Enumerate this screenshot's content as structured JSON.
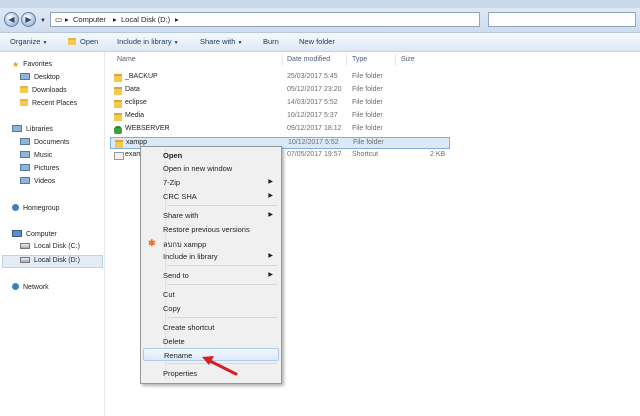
{
  "address": {
    "crumbs": [
      "Computer",
      "Local Disk (D:)"
    ]
  },
  "toolbar": {
    "organize": "Organize",
    "open": "Open",
    "include_in_library": "Include in library",
    "share_with": "Share with",
    "burn": "Burn",
    "new_folder": "New folder"
  },
  "nav": {
    "favorites": "Favorites",
    "desktop": "Desktop",
    "downloads": "Downloads",
    "recent_places": "Recent Places",
    "libraries": "Libraries",
    "documents": "Documents",
    "music": "Music",
    "pictures": "Pictures",
    "videos": "Videos",
    "homegroup": "Homegroup",
    "computer": "Computer",
    "local_c": "Local Disk (C:)",
    "local_d": "Local Disk (D:)",
    "network": "Network"
  },
  "columns": {
    "name": "Name",
    "date_modified": "Date modified",
    "type": "Type",
    "size": "Size"
  },
  "files": [
    {
      "name": "_BACKUP",
      "date": "25/03/2017 5:45",
      "type": "File folder",
      "size": ""
    },
    {
      "name": "Data",
      "date": "05/12/2017 23:20",
      "type": "File folder",
      "size": ""
    },
    {
      "name": "eclipse",
      "date": "14/03/2017 5:52",
      "type": "File folder",
      "size": ""
    },
    {
      "name": "Media",
      "date": "10/12/2017 5:37",
      "type": "File folder",
      "size": ""
    },
    {
      "name": "WEBSERVER",
      "date": "09/12/2017 18:12",
      "type": "File folder",
      "size": ""
    },
    {
      "name": "xampp",
      "date": "10/12/2017 5:52",
      "type": "File folder",
      "size": ""
    },
    {
      "name": "exam",
      "date": "07/05/2017 19:57",
      "type": "Shortcut",
      "size": "2 KB"
    }
  ],
  "context_menu": {
    "open": "Open",
    "open_new_window": "Open in new window",
    "seven_zip": "7-Zip",
    "crc_sha": "CRC SHA",
    "share_with": "Share with",
    "restore_previous": "Restore previous versions",
    "xampp_item": "ลบกบ xampp",
    "include_in_library": "Include in library",
    "send_to": "Send to",
    "cut": "Cut",
    "copy": "Copy",
    "create_shortcut": "Create shortcut",
    "delete": "Delete",
    "rename": "Rename",
    "properties": "Properties"
  },
  "colors": {
    "annotation_arrow": "#d42020",
    "selection": "#dce9f8"
  }
}
